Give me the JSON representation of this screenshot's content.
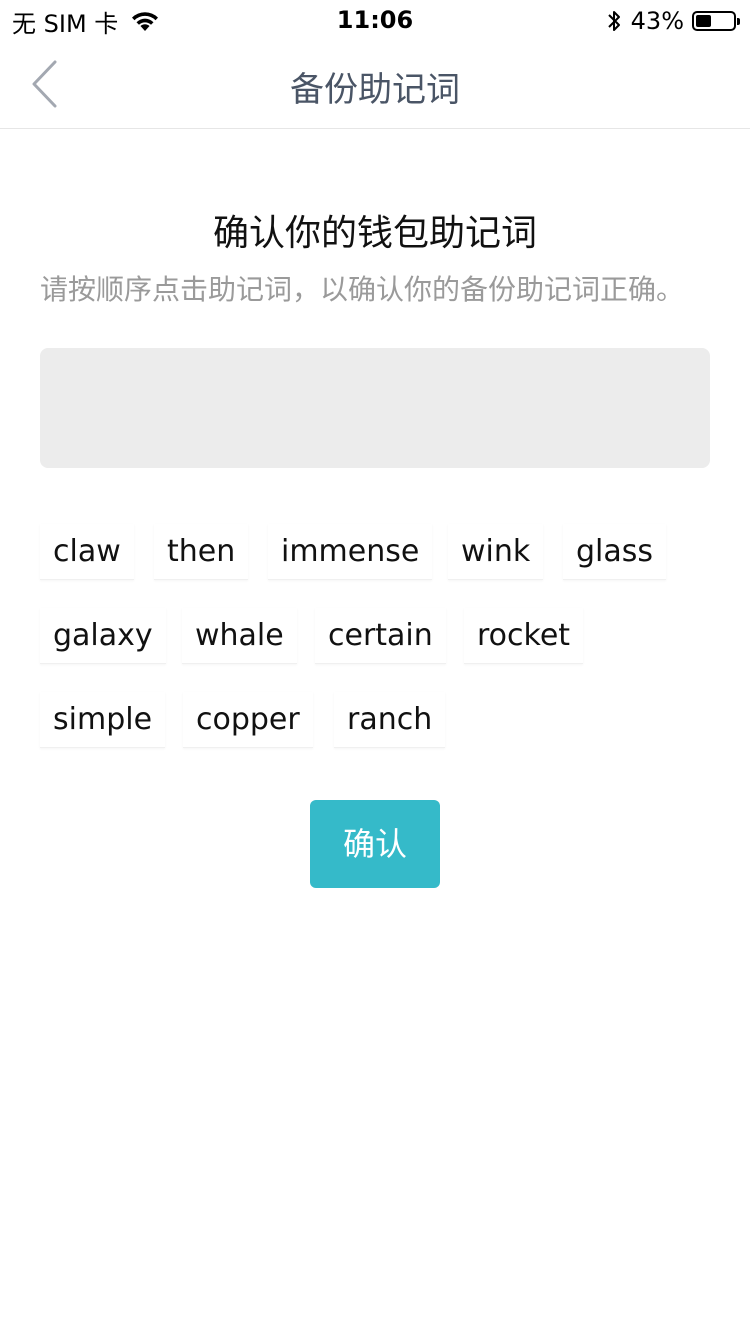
{
  "status_bar": {
    "carrier": "无 SIM 卡",
    "time": "11:06",
    "battery_percent": "43%",
    "battery_level": 0.43,
    "icons": [
      "wifi-icon",
      "bluetooth-icon",
      "battery-icon"
    ]
  },
  "nav": {
    "back_icon": "chevron-left-icon",
    "title": "备份助记词"
  },
  "content": {
    "heading": "确认你的钱包助记词",
    "subtitle": "请按顺序点击助记词，以确认你的备份助记词正确。",
    "words": [
      "claw",
      "then",
      "immense",
      "wink",
      "glass",
      "galaxy",
      "whale",
      "certain",
      "rocket",
      "simple",
      "copper",
      "ranch"
    ],
    "confirm_label": "确认"
  },
  "colors": {
    "accent": "#35bac9",
    "nav_title": "#4a5566",
    "subtitle": "#9a9a9a",
    "selected_box_bg": "#ececec"
  }
}
